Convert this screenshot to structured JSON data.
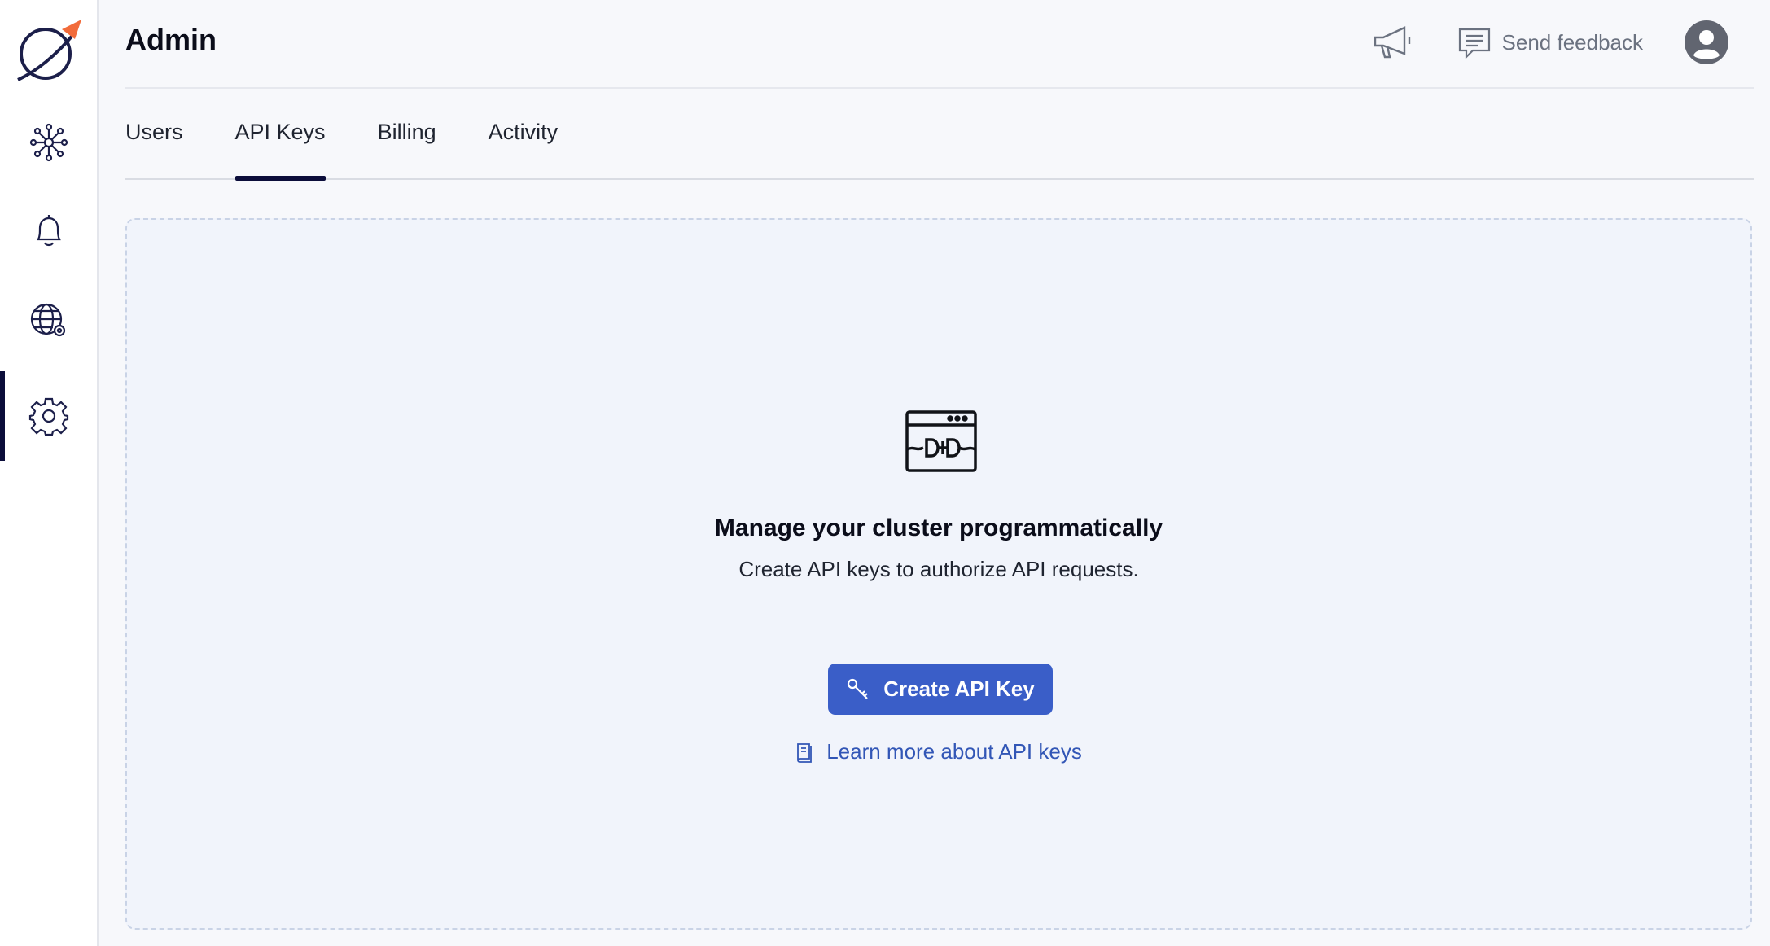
{
  "sidebar": {
    "items": [
      {
        "icon": "network-icon"
      },
      {
        "icon": "bell-icon"
      },
      {
        "icon": "globe-settings-icon"
      },
      {
        "icon": "gear-icon",
        "active": true
      }
    ]
  },
  "header": {
    "title": "Admin",
    "feedback_label": "Send feedback"
  },
  "tabs": [
    {
      "label": "Users"
    },
    {
      "label": "API Keys",
      "active": true
    },
    {
      "label": "Billing"
    },
    {
      "label": "Activity"
    }
  ],
  "empty_state": {
    "title": "Manage your cluster programmatically",
    "description": "Create API keys to authorize API requests.",
    "create_button": "Create API Key",
    "learn_link": "Learn more about API keys"
  },
  "colors": {
    "accent": "#3a5ec8",
    "link": "#3256b6",
    "nav_active": "#0b0d3a",
    "logo_orange": "#f26b3a"
  }
}
